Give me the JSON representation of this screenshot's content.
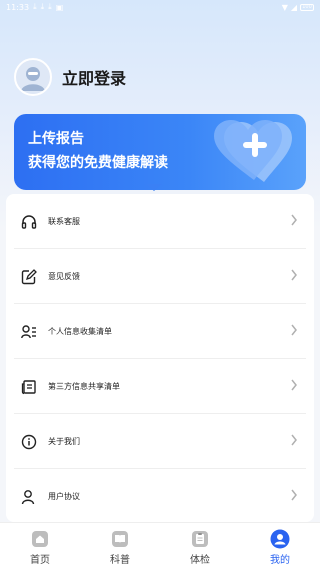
{
  "status_bar": {
    "time": "11:33",
    "battery": "100"
  },
  "profile": {
    "login_label": "立即登录"
  },
  "banner": {
    "title": "上传报告",
    "subtitle": "获得您的免费健康解读"
  },
  "menu": {
    "items": [
      {
        "label": "联系客服",
        "icon": "headset-icon"
      },
      {
        "label": "意见反馈",
        "icon": "edit-icon"
      },
      {
        "label": "个人信息收集清单",
        "icon": "user-list-icon"
      },
      {
        "label": "第三方信息共享清单",
        "icon": "document-icon"
      },
      {
        "label": "关于我们",
        "icon": "info-icon"
      },
      {
        "label": "用户协议",
        "icon": "user-agreement-icon"
      }
    ]
  },
  "tabbar": {
    "tabs": [
      {
        "label": "首页",
        "icon": "home-icon",
        "active": false
      },
      {
        "label": "科普",
        "icon": "book-icon",
        "active": false
      },
      {
        "label": "体检",
        "icon": "clipboard-icon",
        "active": false
      },
      {
        "label": "我的",
        "icon": "profile-icon",
        "active": true
      }
    ]
  },
  "colors": {
    "accent": "#2a63f0",
    "banner_start": "#2d6ff2",
    "banner_end": "#5aa2fb"
  }
}
